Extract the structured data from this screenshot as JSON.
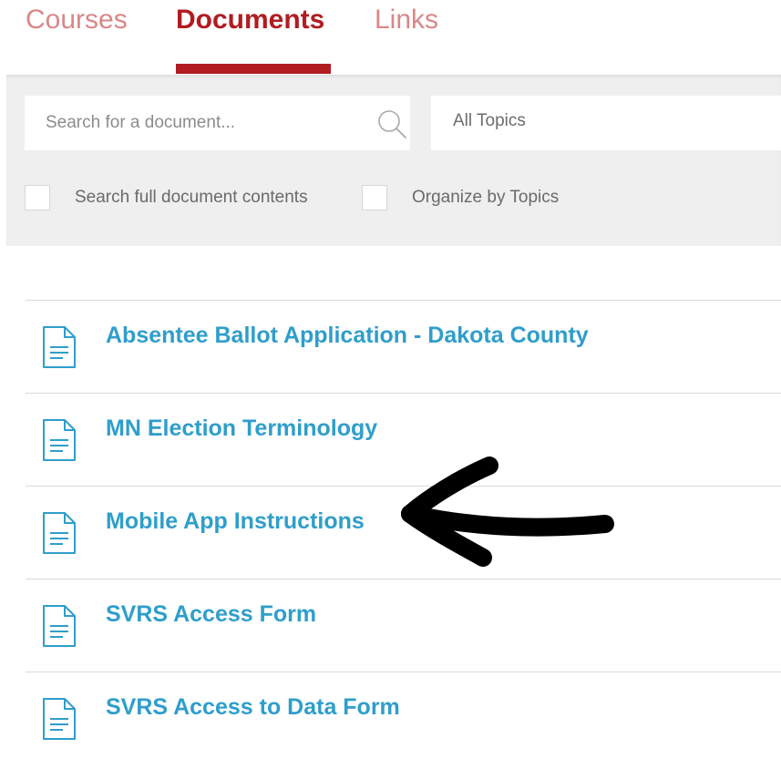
{
  "tabs": [
    {
      "label": "Courses",
      "active": false
    },
    {
      "label": "Documents",
      "active": true
    },
    {
      "label": "Links",
      "active": false
    }
  ],
  "filters": {
    "search_placeholder": "Search for a document...",
    "search_value": "",
    "topic_selected": "All Topics",
    "full_contents_label": "Search full document contents",
    "full_contents_checked": false,
    "organize_label": "Organize by Topics",
    "organize_checked": false
  },
  "documents": [
    {
      "title": "Absentee Ballot Application - Dakota County",
      "icon": "document-icon"
    },
    {
      "title": "MN Election Terminology",
      "icon": "document-icon"
    },
    {
      "title": "Mobile App Instructions",
      "icon": "document-icon"
    },
    {
      "title": "SVRS Access Form",
      "icon": "document-icon"
    },
    {
      "title": "SVRS Access to Data Form",
      "icon": "document-icon"
    }
  ],
  "colors": {
    "accent_red": "#b11c22",
    "inactive_tab": "#d98789",
    "link_blue": "#2f9ecb",
    "panel_bg": "#efefef",
    "annotation": "#000000"
  }
}
